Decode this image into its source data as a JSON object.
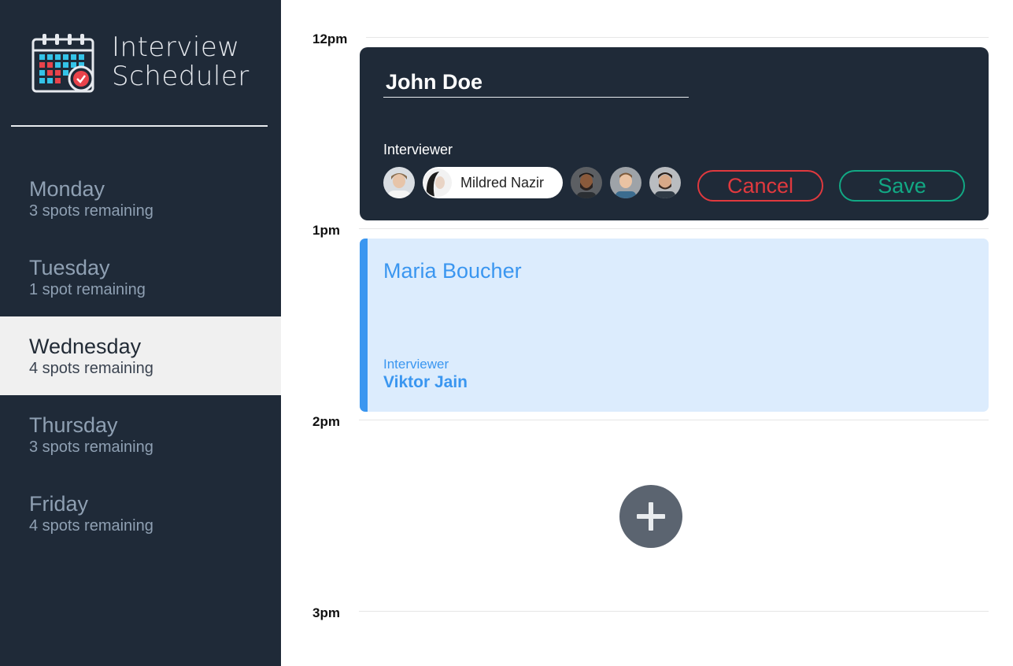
{
  "app": {
    "title_line1": "Interview",
    "title_line2": "Scheduler"
  },
  "days": [
    {
      "name": "Monday",
      "spots": "3 spots remaining",
      "selected": false
    },
    {
      "name": "Tuesday",
      "spots": "1 spot remaining",
      "selected": false
    },
    {
      "name": "Wednesday",
      "spots": "4 spots remaining",
      "selected": true
    },
    {
      "name": "Thursday",
      "spots": "3 spots remaining",
      "selected": false
    },
    {
      "name": "Friday",
      "spots": "4 spots remaining",
      "selected": false
    }
  ],
  "schedule": {
    "times": [
      "12pm",
      "1pm",
      "2pm",
      "3pm"
    ],
    "form": {
      "student_name": "John Doe",
      "interviewer_label": "Interviewer",
      "selected_interviewer": "Mildred Nazir",
      "cancel_label": "Cancel",
      "save_label": "Save"
    },
    "appointment": {
      "student": "Maria Boucher",
      "interviewer_label": "Interviewer",
      "interviewer": "Viktor Jain"
    },
    "add_icon": "plus-icon"
  },
  "colors": {
    "sidebar_bg": "#1f2a38",
    "selected_day_bg": "#f0f0f0",
    "cancel": "#e0393e",
    "save": "#12a884",
    "appointment_accent": "#3a96f0",
    "appointment_bg": "#dcecfd",
    "add_button": "#5b6470"
  }
}
